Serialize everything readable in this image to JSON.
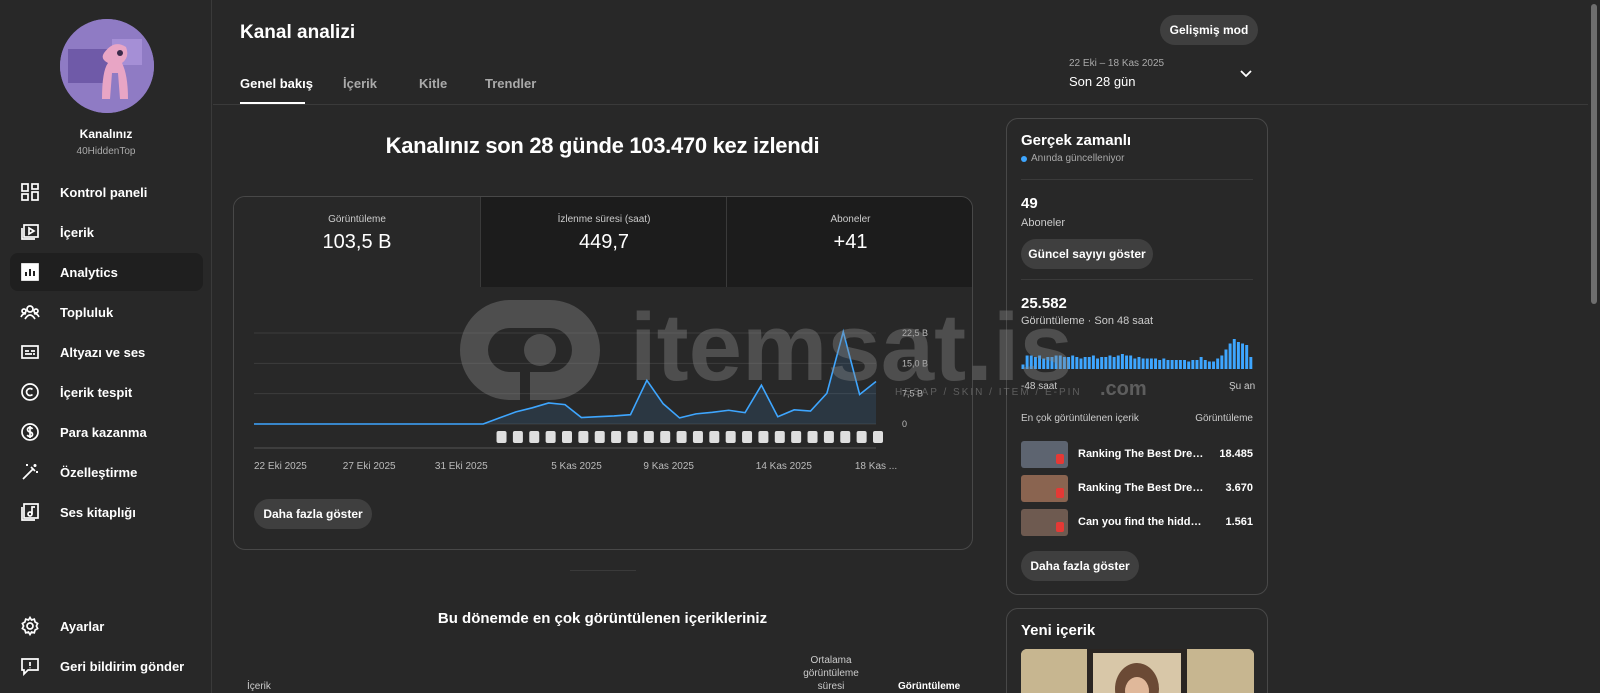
{
  "channel": {
    "name": "Kanalınız",
    "handle": "40HiddenTop"
  },
  "sidebar": {
    "items": [
      {
        "label": "Kontrol paneli",
        "icon": "dashboard-icon"
      },
      {
        "label": "İçerik",
        "icon": "content-icon"
      },
      {
        "label": "Analytics",
        "icon": "analytics-icon",
        "active": true
      },
      {
        "label": "Topluluk",
        "icon": "community-icon"
      },
      {
        "label": "Altyazı ve ses",
        "icon": "subtitles-icon"
      },
      {
        "label": "İçerik tespit",
        "icon": "copyright-icon"
      },
      {
        "label": "Para kazanma",
        "icon": "dollar-icon"
      },
      {
        "label": "Özelleştirme",
        "icon": "magic-wand-icon"
      },
      {
        "label": "Ses kitaplığı",
        "icon": "audio-library-icon"
      }
    ],
    "bottom": [
      {
        "label": "Ayarlar",
        "icon": "gear-icon"
      },
      {
        "label": "Geri bildirim gönder",
        "icon": "feedback-icon"
      }
    ]
  },
  "header": {
    "title": "Kanal analizi",
    "tabs": [
      "Genel bakış",
      "İçerik",
      "Kitle",
      "Trendler"
    ],
    "advanced_button": "Gelişmiş mod",
    "date_range": "22 Eki – 18 Kas 2025",
    "date_label": "Son 28 gün"
  },
  "main": {
    "headline": "Kanalınız son 28 günde 103.470 kez izlendi",
    "metrics": [
      {
        "title": "Görüntüleme",
        "value": "103,5 B"
      },
      {
        "title": "İzlenme süresi (saat)",
        "value": "449,7"
      },
      {
        "title": "Aboneler",
        "value": "+41"
      }
    ],
    "more_button": "Daha fazla göster",
    "top_content_title": "Bu dönemde en çok görüntülenen içerikleriniz",
    "table_headers": {
      "content": "İçerik",
      "avg": "Ortalama görüntüleme süresi",
      "views": "Görüntüleme"
    }
  },
  "chart_data": {
    "type": "area",
    "x_ticks": [
      "22 Eki 2025",
      "27 Eki 2025",
      "31 Eki 2025",
      "5 Kas 2025",
      "9 Kas 2025",
      "14 Kas 2025",
      "18 Kas ..."
    ],
    "y_ticks": [
      "22,5 B",
      "15,0 B",
      "7,5 B",
      "0"
    ],
    "ylim": [
      0,
      22500
    ],
    "series": [
      {
        "values": [
          0,
          0,
          0,
          0,
          0,
          0,
          0,
          0,
          0,
          0,
          0,
          0,
          0,
          0,
          0,
          1500,
          3000,
          4000,
          5200,
          4800,
          1600,
          1800,
          2000,
          2300,
          10800,
          5000,
          1500,
          2500,
          2900,
          3400,
          2800,
          9600,
          1800,
          3500,
          3200,
          7600,
          22800,
          7300,
          10500
        ]
      }
    ],
    "color": "#3ea6ff"
  },
  "realtime": {
    "title": "Gerçek zamanlı",
    "subtitle": "Anında güncelleniyor",
    "subscribers_value": "49",
    "subscribers_label": "Aboneler",
    "show_count_button": "Güncel sayıyı göster",
    "views_value": "25.582",
    "views_label": "Görüntüleme · Son 48 saat",
    "spark_left": "-48 saat",
    "spark_right": "Şu an",
    "spark_values": [
      3,
      9,
      9,
      8,
      9,
      7,
      8,
      8,
      9,
      9,
      8,
      8,
      9,
      8,
      7,
      8,
      8,
      9,
      7,
      8,
      8,
      9,
      8,
      9,
      10,
      9,
      9,
      7,
      8,
      7,
      7,
      7,
      7,
      6,
      7,
      6,
      6,
      6,
      6,
      6,
      5,
      6,
      6,
      8,
      6,
      5,
      5,
      7,
      9,
      13,
      17,
      20,
      18,
      17,
      16,
      8
    ],
    "top_header_left": "En çok görüntülenen içerik",
    "top_header_right": "Görüntüleme",
    "top_items": [
      {
        "title": "Ranking The Best Dress…",
        "views": "18.485"
      },
      {
        "title": "Ranking The Best Dress …",
        "views": "3.670"
      },
      {
        "title": "Can you find the hidden e…",
        "views": "1.561"
      }
    ],
    "more_button": "Daha fazla göster"
  },
  "new_content": {
    "title": "Yeni içerik"
  },
  "watermark": {
    "text": "itemsat.is",
    "sub": "HESAP / SKIN / ITEM / E-PIN",
    "com": ".com"
  }
}
